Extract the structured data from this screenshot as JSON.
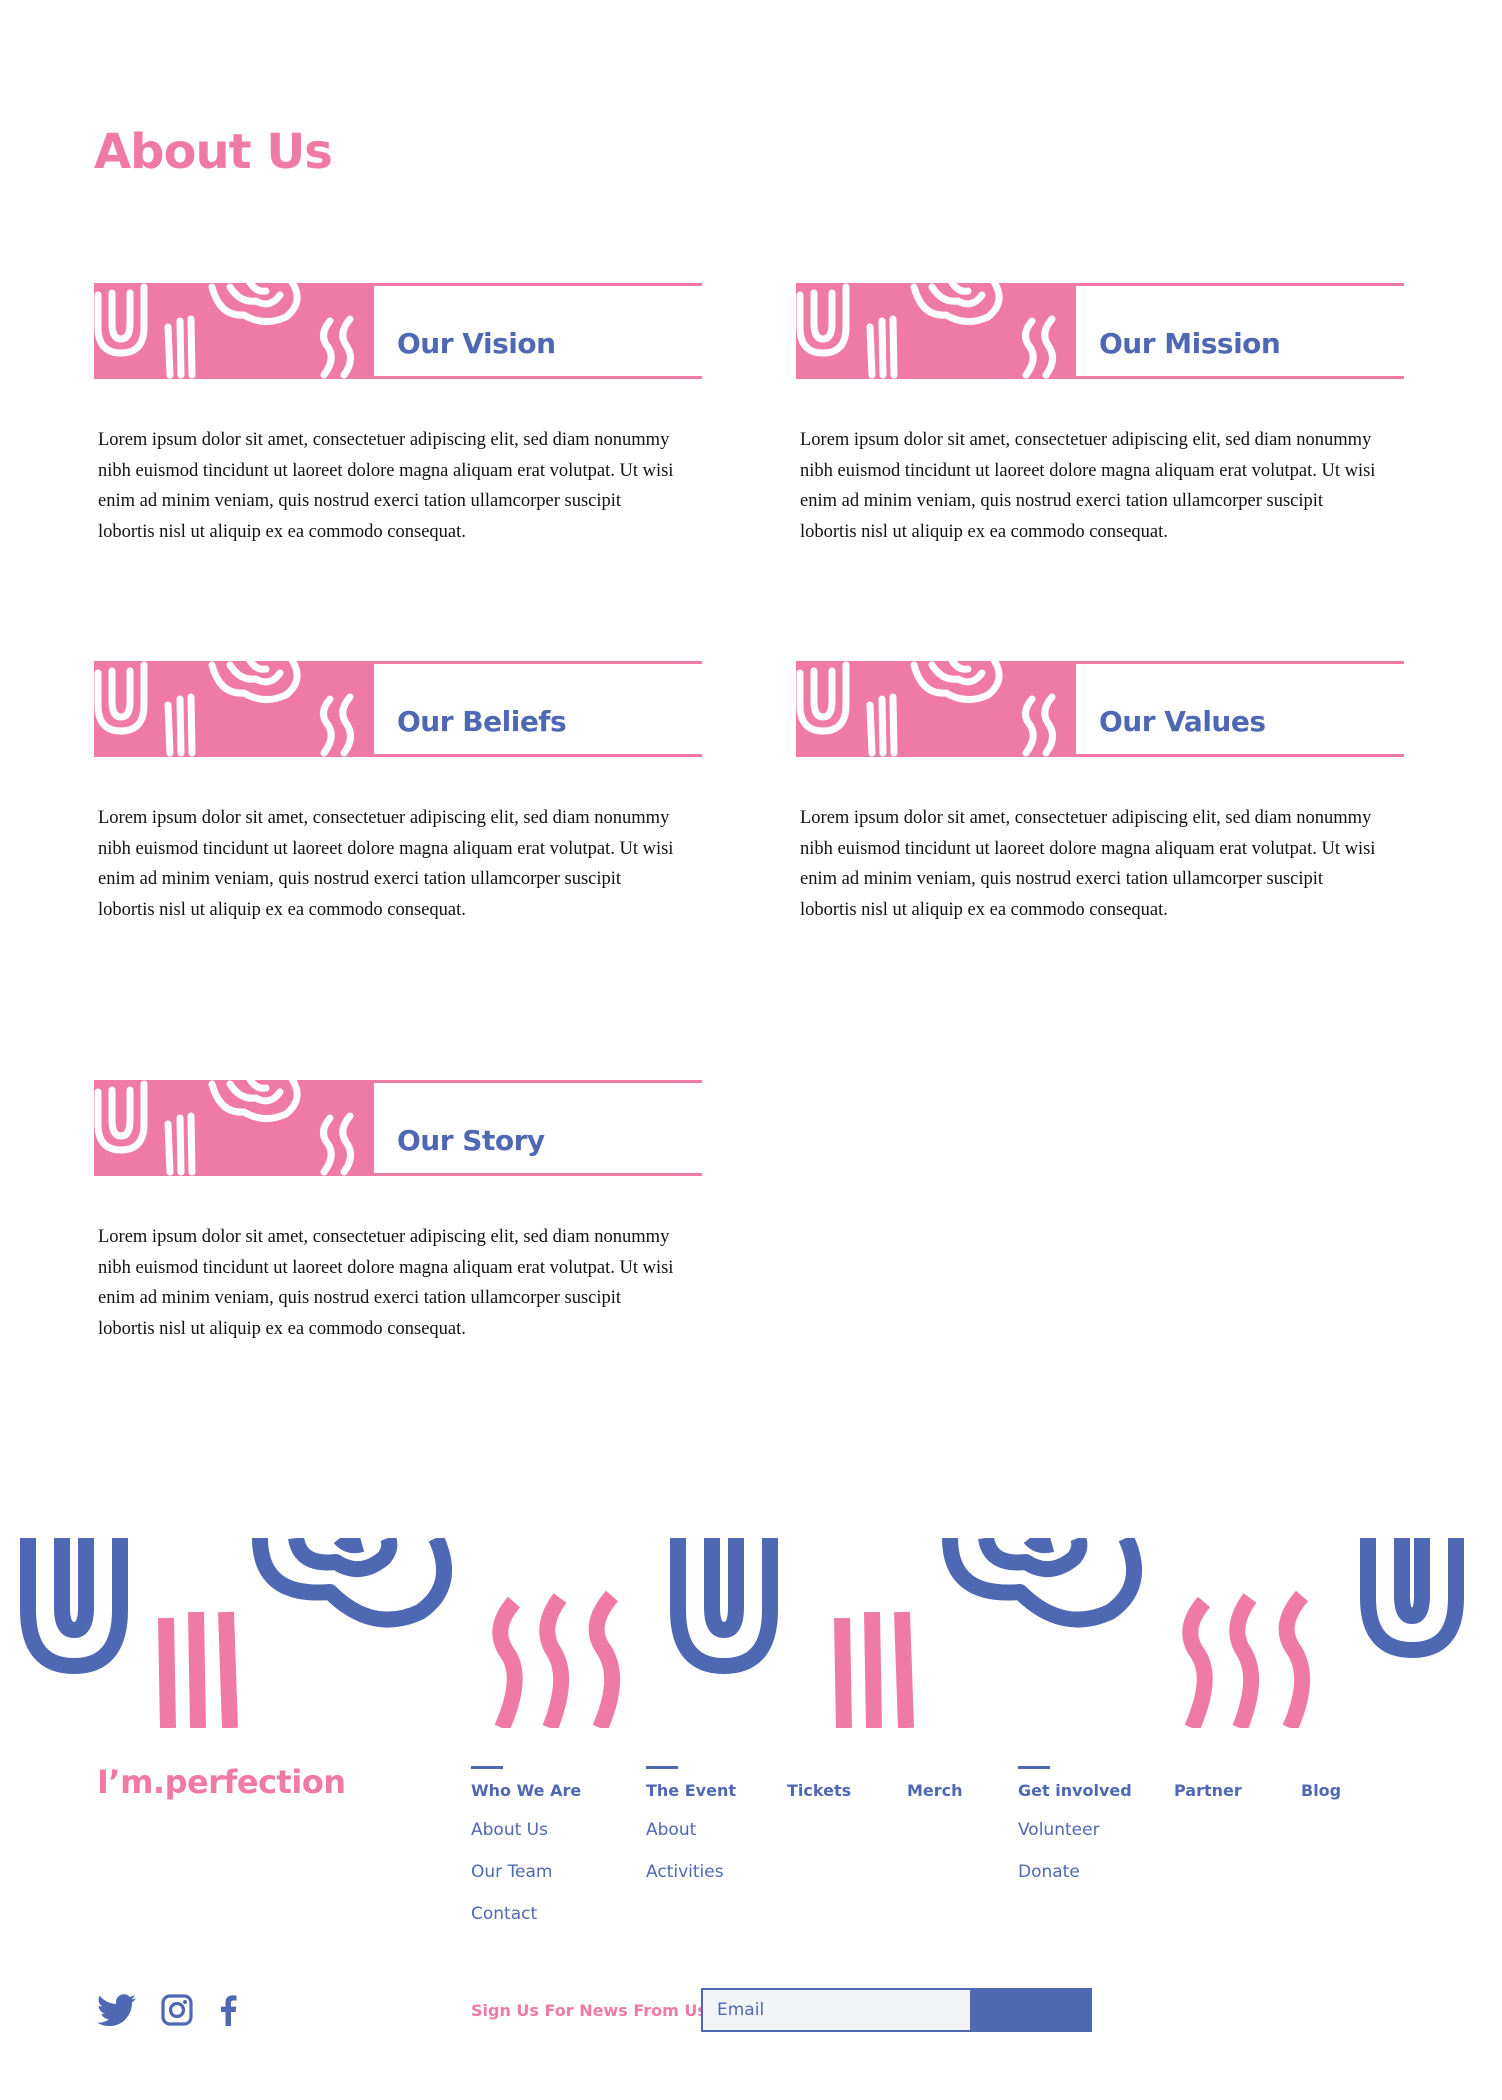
{
  "page": {
    "title": "About Us"
  },
  "sections": [
    {
      "title": "Our Vision",
      "body": "Lorem ipsum dolor sit amet, consectetuer adipiscing elit, sed diam nonummy nibh euismod tincidunt ut laoreet dolore magna aliquam erat volutpat. Ut wisi enim ad minim veniam, quis nostrud exerci tation ullamcorper suscipit lobortis nisl ut aliquip ex ea commodo consequat."
    },
    {
      "title": "Our Mission",
      "body": "Lorem ipsum dolor sit amet, consectetuer adipiscing elit, sed diam nonummy nibh euismod tincidunt ut laoreet dolore magna aliquam erat volutpat. Ut wisi enim ad minim veniam, quis nostrud exerci tation ullamcorper suscipit lobortis nisl ut aliquip ex ea commodo consequat."
    },
    {
      "title": "Our Beliefs",
      "body": "Lorem ipsum dolor sit amet, consectetuer adipiscing elit, sed diam nonummy nibh euismod tincidunt ut laoreet dolore magna aliquam erat volutpat. Ut wisi enim ad minim veniam, quis nostrud exerci tation ullamcorper suscipit lobortis nisl ut aliquip ex ea commodo consequat."
    },
    {
      "title": "Our Values",
      "body": "Lorem ipsum dolor sit amet, consectetuer adipiscing elit, sed diam nonummy nibh euismod tincidunt ut laoreet dolore magna aliquam erat volutpat. Ut wisi enim ad minim veniam, quis nostrud exerci tation ullamcorper suscipit lobortis nisl ut aliquip ex ea commodo consequat."
    },
    {
      "title": "Our Story",
      "body": "Lorem ipsum dolor sit amet, consectetuer adipiscing elit, sed diam nonummy nibh euismod tincidunt ut laoreet dolore magna aliquam erat volutpat. Ut wisi enim ad minim veniam, quis nostrud exerci tation ullamcorper suscipit lobortis nisl ut aliquip ex ea commodo consequat."
    }
  ],
  "footer": {
    "brand": "I’m.perfection",
    "nav": [
      {
        "heading": "Who We Are",
        "links": [
          "About Us",
          "Our Team",
          "Contact"
        ]
      },
      {
        "heading": "The Event",
        "links": [
          "About",
          "Activities"
        ]
      },
      {
        "heading": "Tickets",
        "links": []
      },
      {
        "heading": "Merch",
        "links": []
      },
      {
        "heading": "Get involved",
        "links": [
          "Volunteer",
          "Donate"
        ]
      },
      {
        "heading": "Partner",
        "links": []
      },
      {
        "heading": "Blog",
        "links": []
      }
    ],
    "social": [
      "twitter-icon",
      "instagram-icon",
      "facebook-icon"
    ],
    "newsletter": {
      "label": "Sign Us For News From Us",
      "placeholder": "Email"
    }
  },
  "colors": {
    "pink": "#ef7aa6",
    "blue": "#4f68b3",
    "text": "#111111",
    "input_bg": "#f3f4f7"
  }
}
